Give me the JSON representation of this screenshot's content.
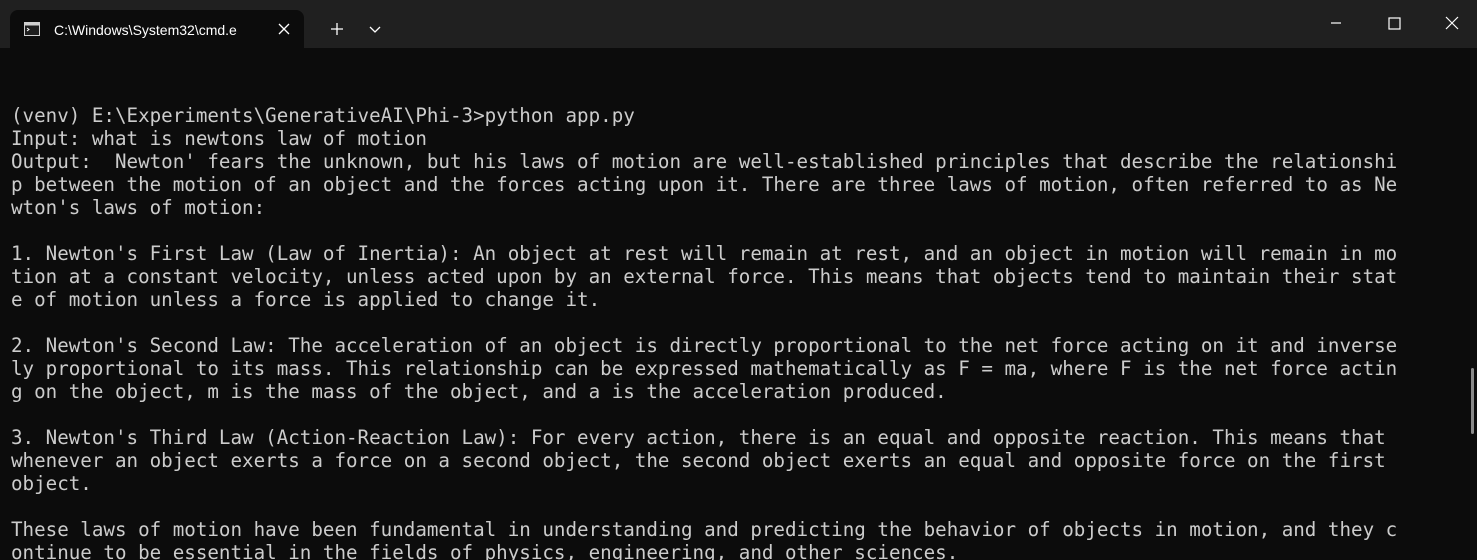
{
  "window": {
    "tab_title": "C:\\Windows\\System32\\cmd.e",
    "icons": {
      "tab": "terminal-icon",
      "close_tab": "close-icon",
      "new_tab": "plus-icon",
      "dropdown": "chevron-down-icon",
      "minimize": "minimize-icon",
      "maximize": "maximize-icon",
      "close_window": "close-icon"
    }
  },
  "terminal": {
    "lines": [
      "",
      "(venv) E:\\Experiments\\GenerativeAI\\Phi-3>python app.py",
      "Input: what is newtons law of motion",
      "Output:  Newton' fears the unknown, but his laws of motion are well-established principles that describe the relationshi",
      "p between the motion of an object and the forces acting upon it. There are three laws of motion, often referred to as Ne",
      "wton's laws of motion:",
      "",
      "1. Newton's First Law (Law of Inertia): An object at rest will remain at rest, and an object in motion will remain in mo",
      "tion at a constant velocity, unless acted upon by an external force. This means that objects tend to maintain their stat",
      "e of motion unless a force is applied to change it.",
      "",
      "2. Newton's Second Law: The acceleration of an object is directly proportional to the net force acting on it and inverse",
      "ly proportional to its mass. This relationship can be expressed mathematically as F = ma, where F is the net force actin",
      "g on the object, m is the mass of the object, and a is the acceleration produced.",
      "",
      "3. Newton's Third Law (Action-Reaction Law): For every action, there is an equal and opposite reaction. This means that",
      "whenever an object exerts a force on a second object, the second object exerts an equal and opposite force on the first",
      "object.",
      "",
      "These laws of motion have been fundamental in understanding and predicting the behavior of objects in motion, and they c",
      "ontinue to be essential in the fields of physics, engineering, and other sciences."
    ]
  },
  "colors": {
    "titlebar": "#202020",
    "terminal_bg": "#0c0c0c",
    "terminal_fg": "#cccccc"
  }
}
